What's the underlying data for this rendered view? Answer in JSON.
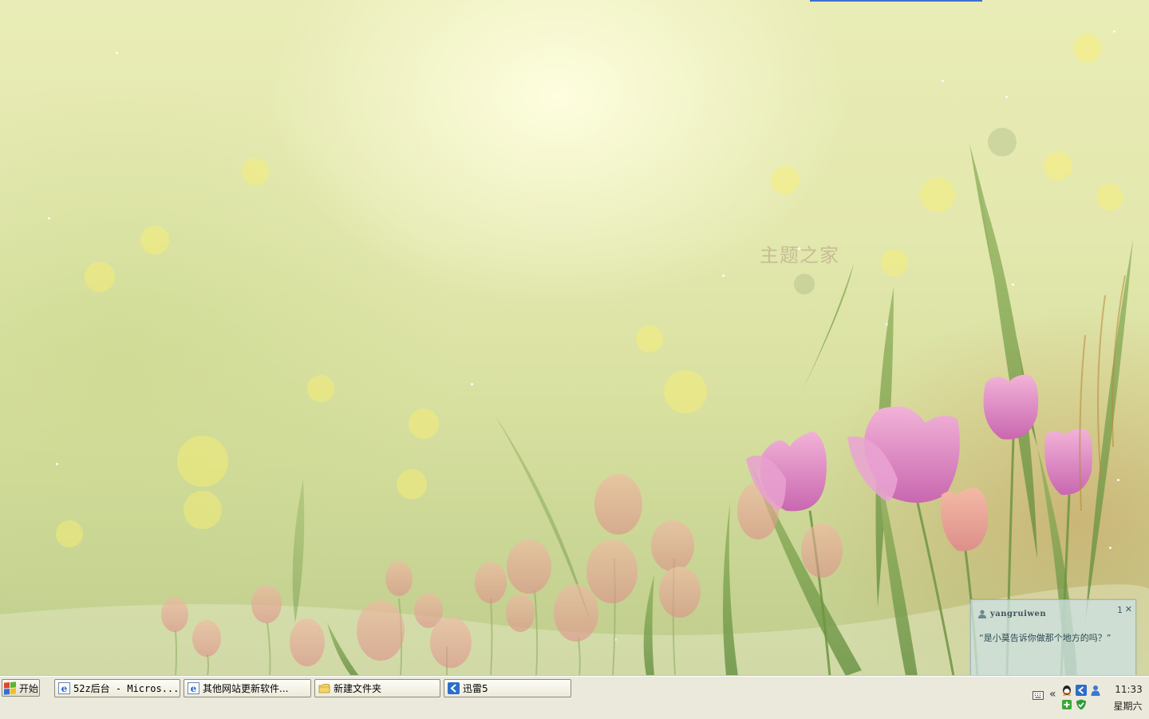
{
  "desktop": {
    "watermark": "主题之家"
  },
  "notification": {
    "username": "yangruiwen",
    "count": "1",
    "close_glyph": "✕",
    "message": "“是小莫告诉你做那个地方的吗？”"
  },
  "taskbar": {
    "start_label": "开始",
    "tasks": [
      {
        "label": "52z后台 - Micros...",
        "icon": "ie-icon"
      },
      {
        "label": "其他网站更新软件...",
        "icon": "ie-icon"
      },
      {
        "label": "新建文件夹",
        "icon": "folder-icon"
      },
      {
        "label": "迅雷5",
        "icon": "thunder-icon"
      }
    ],
    "tray": {
      "expand_glyph": "«",
      "icons": [
        "keyboard-icon",
        "qq-icon",
        "thunder-tray-icon",
        "contacts-icon",
        "update-icon",
        "shield-icon"
      ],
      "time": "11:33",
      "day": "星期六"
    }
  },
  "colors": {
    "accent_blue": "#3d6fd1",
    "taskbar_bg": "#ebe9dc",
    "popup_bg": "#cde0e0"
  }
}
